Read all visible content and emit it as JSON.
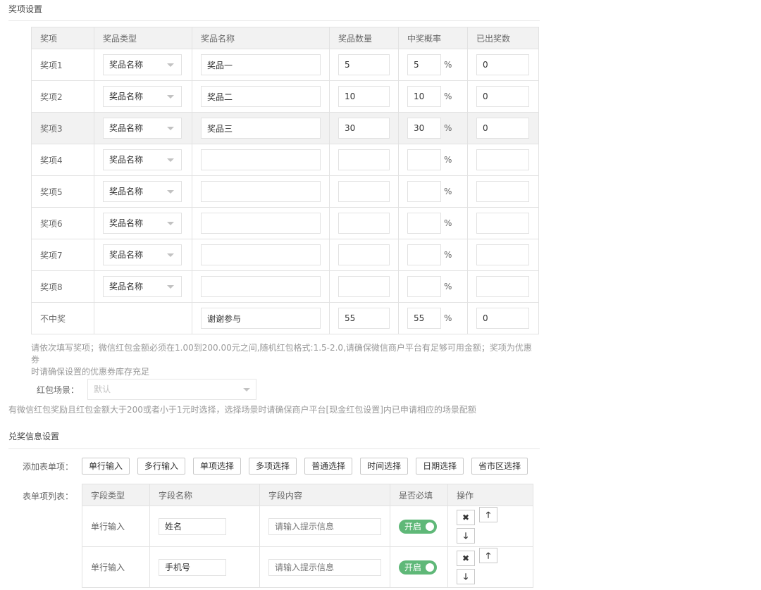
{
  "prize_section": {
    "title": "奖项设置",
    "headers": [
      "奖项",
      "奖品类型",
      "奖品名称",
      "奖品数量",
      "中奖概率",
      "已出奖数"
    ],
    "percent_sign": "%",
    "rows": [
      {
        "label": "奖项1",
        "type": "奖品名称",
        "name": "奖品一",
        "qty": "5",
        "prob": "5",
        "issued": "0",
        "highlight": false
      },
      {
        "label": "奖项2",
        "type": "奖品名称",
        "name": "奖品二",
        "qty": "10",
        "prob": "10",
        "issued": "0",
        "highlight": false
      },
      {
        "label": "奖项3",
        "type": "奖品名称",
        "name": "奖品三",
        "qty": "30",
        "prob": "30",
        "issued": "0",
        "highlight": true
      },
      {
        "label": "奖项4",
        "type": "奖品名称",
        "name": "",
        "qty": "",
        "prob": "",
        "issued": "",
        "highlight": false
      },
      {
        "label": "奖项5",
        "type": "奖品名称",
        "name": "",
        "qty": "",
        "prob": "",
        "issued": "",
        "highlight": false
      },
      {
        "label": "奖项6",
        "type": "奖品名称",
        "name": "",
        "qty": "",
        "prob": "",
        "issued": "",
        "highlight": false
      },
      {
        "label": "奖项7",
        "type": "奖品名称",
        "name": "",
        "qty": "",
        "prob": "",
        "issued": "",
        "highlight": false
      },
      {
        "label": "奖项8",
        "type": "奖品名称",
        "name": "",
        "qty": "",
        "prob": "",
        "issued": "",
        "highlight": false
      },
      {
        "label": "不中奖",
        "type": null,
        "name": "谢谢参与",
        "qty": "55",
        "prob": "55",
        "issued": "0",
        "highlight": false
      }
    ],
    "note_line1": "请依次填写奖项；微信红包金额必须在1.00到200.00元之间,随机红包格式:1.5-2.0,请确保微信商户平台有足够可用金额；奖项为优惠券",
    "note_line2": "时请确保设置的优惠券库存充足"
  },
  "redpacket": {
    "label": "红包场景：",
    "select_value": "默认",
    "note": "有微信红包奖励且红包金额大于200或者小于1元时选择，选择场景时请确保商户平台[现金红包设置]内已申请相应的场景配额"
  },
  "redeem_section": {
    "title": "兑奖信息设置",
    "add_label": "添加表单项：",
    "buttons": [
      "单行输入",
      "多行输入",
      "单项选择",
      "多项选择",
      "普通选择",
      "时间选择",
      "日期选择",
      "省市区选择"
    ],
    "list_label": "表单项列表：",
    "headers": [
      "字段类型",
      "字段名称",
      "字段内容",
      "是否必填",
      "操作"
    ],
    "rows": [
      {
        "type": "单行输入",
        "name": "姓名",
        "content_placeholder": "请输入提示信息",
        "required": "开启"
      },
      {
        "type": "单行输入",
        "name": "手机号",
        "content_placeholder": "请输入提示信息",
        "required": "开启"
      }
    ]
  },
  "icons": {
    "delete": "close-icon",
    "up": "arrow-up-icon",
    "down": "arrow-down-icon"
  },
  "colors": {
    "toggle_on": "#5fb878",
    "header_bg": "#f2f2f2",
    "border": "#e2e2e2"
  }
}
